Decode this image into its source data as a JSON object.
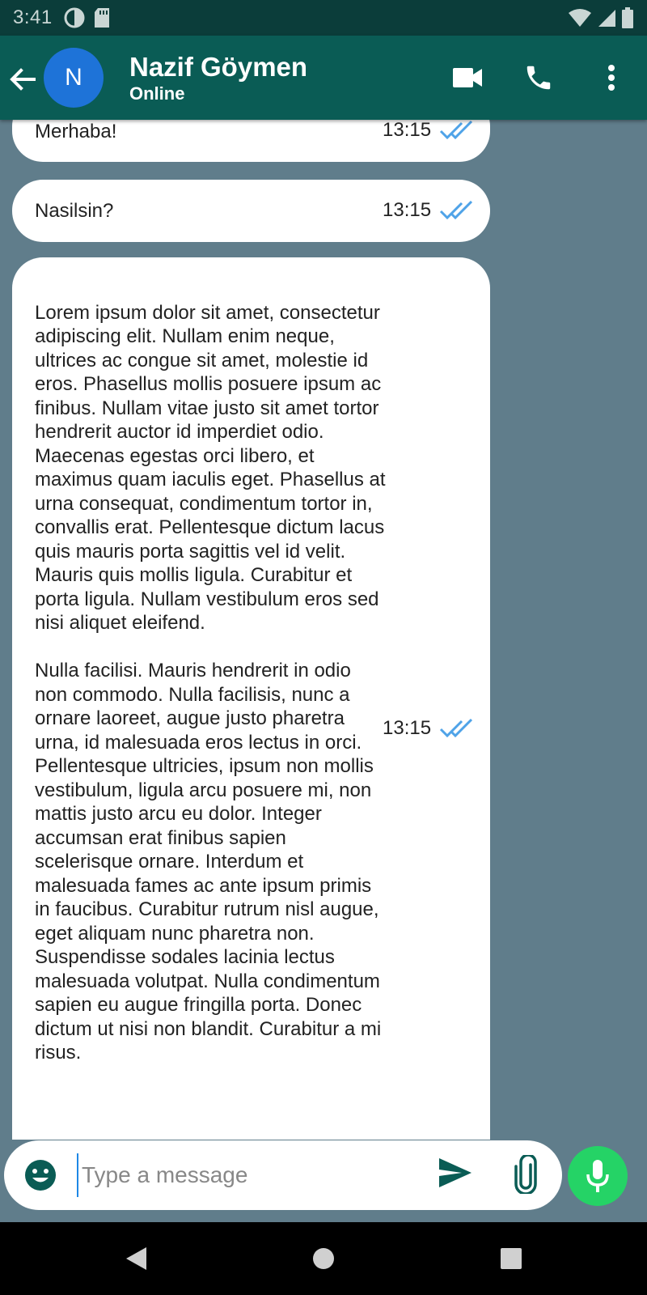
{
  "status_bar": {
    "time": "3:41",
    "icons": [
      "data-saver-icon",
      "sd-card-icon",
      "wifi-icon",
      "cell-signal-icon",
      "battery-icon"
    ]
  },
  "header": {
    "avatar_initial": "N",
    "contact_name": "Nazif Göymen",
    "contact_status": "Online",
    "icons": [
      "back-arrow-icon",
      "video-call-icon",
      "phone-call-icon",
      "more-vert-icon"
    ]
  },
  "messages": [
    {
      "text": "Merhaba!",
      "time": "13:15",
      "status": "read"
    },
    {
      "text": "Nasilsin?",
      "time": "13:15",
      "status": "read"
    },
    {
      "text": "\nLorem ipsum dolor sit amet, consectetur adipiscing elit. Nullam enim neque, ultrices ac congue sit amet, molestie id eros. Phasellus mollis posuere ipsum ac finibus. Nullam vitae justo sit amet tortor hendrerit auctor id imperdiet odio. Maecenas egestas orci libero, et maximus quam iaculis eget. Phasellus at urna consequat, condimentum tortor in, convallis erat. Pellentesque dictum lacus quis mauris porta sagittis vel id velit. Mauris quis mollis ligula. Curabitur et porta ligula. Nullam vestibulum eros sed nisi aliquet eleifend.\n\nNulla facilisi. Mauris hendrerit in odio non commodo. Nulla facilisis, nunc a ornare laoreet, augue justo pharetra urna, id malesuada eros lectus in orci. Pellentesque ultricies, ipsum non mollis vestibulum, ligula arcu posuere mi, non mattis justo arcu eu dolor. Integer accumsan erat finibus sapien scelerisque ornare. Interdum et malesuada fames ac ante ipsum primis in faucibus. Curabitur rutrum nisl augue, eget aliquam nunc pharetra non. Suspendisse sodales lacinia lectus malesuada volutpat. Nulla condimentum sapien eu augue fringilla porta. Donec dictum ut nisi non blandit. Curabitur a mi risus.",
      "time": "13:15",
      "status": "read"
    }
  ],
  "input": {
    "placeholder": "Type a message",
    "value": ""
  },
  "colors": {
    "status_bar": "#0b3d3a",
    "app_bar": "#0a5c55",
    "chat_background": "#607d8b",
    "avatar": "#1e73d8",
    "read_tick": "#4fa3e8",
    "mic_button": "#25d366",
    "send_icon": "#0a5c55"
  },
  "nav_bar": {
    "icons": [
      "nav-back-icon",
      "nav-home-icon",
      "nav-recents-icon"
    ]
  }
}
